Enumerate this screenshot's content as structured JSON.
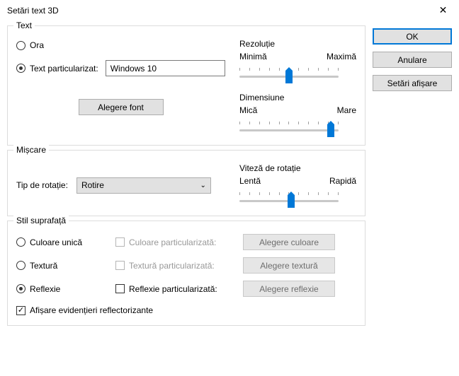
{
  "window": {
    "title": "Setări text 3D"
  },
  "buttons": {
    "ok": "OK",
    "cancel": "Anulare",
    "display": "Setări afișare"
  },
  "text_group": {
    "legend": "Text",
    "radio_time": "Ora",
    "radio_custom": "Text particularizat:",
    "custom_value": "Windows 10",
    "choose_font": "Alegere font",
    "resolution": {
      "title": "Rezoluție",
      "min": "Minimă",
      "max": "Maximă"
    },
    "size": {
      "title": "Dimensiune",
      "min": "Mică",
      "max": "Mare"
    }
  },
  "move_group": {
    "legend": "Mișcare",
    "rotation_type_label": "Tip de rotație:",
    "rotation_type_value": "Rotire",
    "speed": {
      "title": "Viteză de rotație",
      "min": "Lentă",
      "max": "Rapidă"
    }
  },
  "surf_group": {
    "legend": "Stil suprafață",
    "solid": "Culoare unică",
    "texture": "Textură",
    "reflection": "Reflexie",
    "custom_color": "Culoare particularizată:",
    "custom_texture": "Textură particularizată:",
    "custom_reflection": "Reflexie particularizată:",
    "choose_color": "Alegere culoare",
    "choose_texture": "Alegere textură",
    "choose_reflection": "Alegere reflexie",
    "show_highlights": "Afișare evidențieri reflectorizante"
  }
}
